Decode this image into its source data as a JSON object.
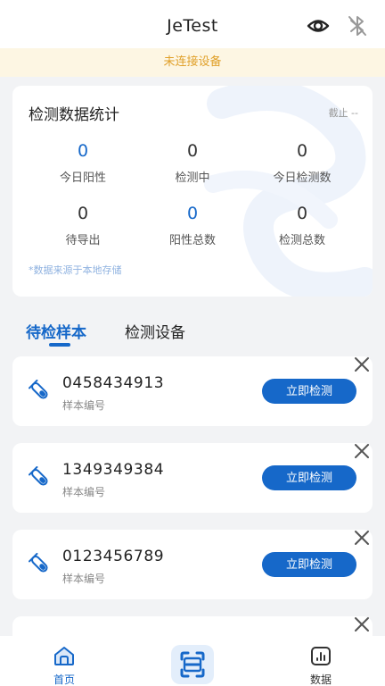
{
  "header": {
    "title": "JeTest"
  },
  "banner": {
    "text": "未连接设备"
  },
  "stats": {
    "title": "检测数据统计",
    "cutoff": "截止 --",
    "items": [
      {
        "value": "0",
        "label": "今日阳性"
      },
      {
        "value": "0",
        "label": "检测中"
      },
      {
        "value": "0",
        "label": "今日检测数"
      },
      {
        "value": "0",
        "label": "待导出"
      },
      {
        "value": "0",
        "label": "阳性总数"
      },
      {
        "value": "0",
        "label": "检测总数"
      }
    ],
    "note": "*数据来源于本地存储"
  },
  "tabs": [
    {
      "label": "待检样本",
      "active": true
    },
    {
      "label": "检测设备",
      "active": false
    }
  ],
  "samples": [
    {
      "id": "0458434913",
      "label": "样本编号",
      "action": "立即检测"
    },
    {
      "id": "1349349384",
      "label": "样本编号",
      "action": "立即检测"
    },
    {
      "id": "0123456789",
      "label": "样本编号",
      "action": "立即检测"
    }
  ],
  "nav": {
    "home": "首页",
    "data": "数据"
  },
  "colors": {
    "primary": "#1668c9",
    "banner_bg": "#fdf6e3",
    "banner_text": "#e0a02a"
  }
}
